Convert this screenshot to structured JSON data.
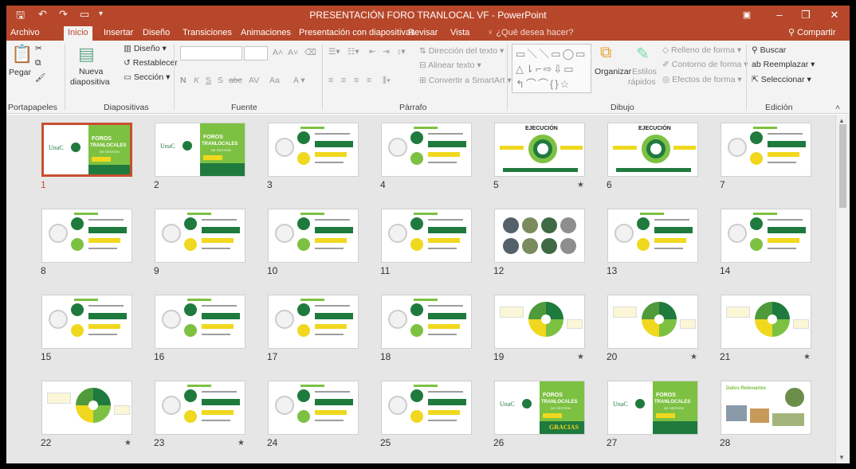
{
  "window": {
    "title": "PRESENTACIÓN FORO TRANLOCAL VF - PowerPoint",
    "controls": [
      "restore-ribbon-icon",
      "minimize-icon",
      "maximize-icon",
      "close-icon"
    ]
  },
  "tabs": [
    "Archivo",
    "Inicio",
    "Insertar",
    "Diseño",
    "Transiciones",
    "Animaciones",
    "Presentación con diapositivas",
    "Revisar",
    "Vista"
  ],
  "active_tab": "Inicio",
  "tell_me": "¿Qué desea hacer?",
  "share": "Compartir",
  "ribbon": {
    "portapapeles": {
      "paste": "Pegar",
      "label": "Portapapeles"
    },
    "diapositivas": {
      "new_slide_1": "Nueva",
      "new_slide_2": "diapositiva",
      "layout": "Diseño",
      "reset": "Restablecer",
      "section": "Sección",
      "label": "Diapositivas"
    },
    "fuente": {
      "label": "Fuente",
      "letters": [
        "N",
        "K",
        "S",
        "S",
        "abc",
        "AV",
        "Aa"
      ]
    },
    "parrafo": {
      "text_direction": "Dirección del texto",
      "align_text": "Alinear texto",
      "smartart": "Convertir a SmartArt",
      "label": "Párrafo"
    },
    "dibujo": {
      "arrange": "Organizar",
      "styles_1": "Estilos",
      "styles_2": "rápidos",
      "fill": "Relleno de forma",
      "outline": "Contorno de forma",
      "effects": "Efectos de forma",
      "label": "Dibujo"
    },
    "edicion": {
      "find": "Buscar",
      "replace": "Reemplazar",
      "select": "Seleccionar",
      "label": "Edición"
    }
  },
  "slides": [
    {
      "n": "1",
      "star": false,
      "selected": true
    },
    {
      "n": "2",
      "star": false
    },
    {
      "n": "3",
      "star": false
    },
    {
      "n": "4",
      "star": false
    },
    {
      "n": "5",
      "star": true
    },
    {
      "n": "6",
      "star": false
    },
    {
      "n": "7",
      "star": false
    },
    {
      "n": "8",
      "star": false
    },
    {
      "n": "9",
      "star": false
    },
    {
      "n": "10",
      "star": false
    },
    {
      "n": "11",
      "star": false
    },
    {
      "n": "12",
      "star": false
    },
    {
      "n": "13",
      "star": false
    },
    {
      "n": "14",
      "star": false
    },
    {
      "n": "15",
      "star": false
    },
    {
      "n": "16",
      "star": false
    },
    {
      "n": "17",
      "star": false
    },
    {
      "n": "18",
      "star": false
    },
    {
      "n": "19",
      "star": true
    },
    {
      "n": "20",
      "star": true
    },
    {
      "n": "21",
      "star": true
    },
    {
      "n": "22",
      "star": true
    },
    {
      "n": "23",
      "star": true
    },
    {
      "n": "24",
      "star": false
    },
    {
      "n": "25",
      "star": false
    },
    {
      "n": "26",
      "star": false
    },
    {
      "n": "27",
      "star": false
    },
    {
      "n": "28",
      "star": false
    }
  ],
  "slide_text": {
    "foros": "FOROS",
    "tranlocales": "TRANLOCALES",
    "de_gestion": "DE GESTIÓN",
    "ejecucion": "EJECUCIÓN",
    "gracias": "GRACIAS",
    "datos_relevantes": "Datos Relevantes",
    "logo": "UnaC"
  },
  "colors": {
    "accent": "#b7472a",
    "selection": "#c8502f",
    "dark_green": "#1f7a3e",
    "light_green": "#7dc142",
    "yellow": "#f0d81e"
  },
  "star_glyph": "★"
}
